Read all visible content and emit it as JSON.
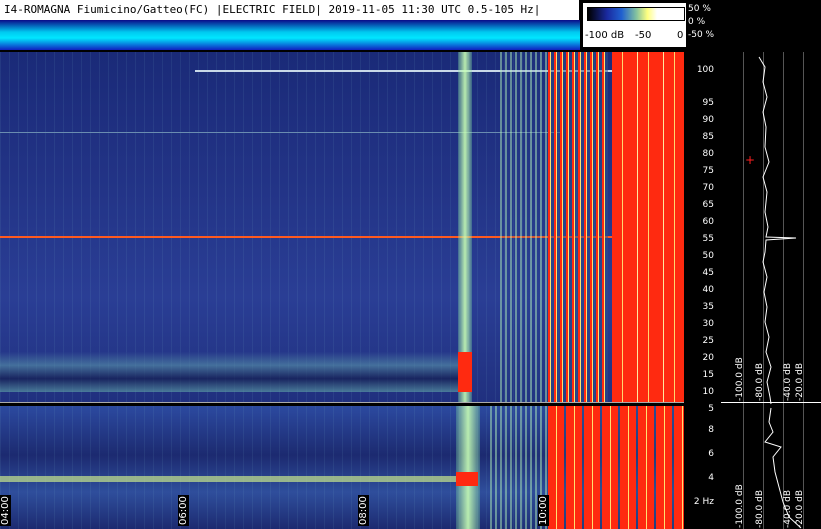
{
  "header": {
    "title": "I4-ROMAGNA Fiumicino/Gatteo(FC) |ELECTRIC FIELD| 2019-11-05 11:30 UTC 0.5-105 Hz|"
  },
  "scale": {
    "labels": [
      "-100 dB",
      "-50",
      "0"
    ],
    "percent_labels": [
      "50 %",
      "0 %",
      "-50 %"
    ]
  },
  "freq_axis_top": {
    "labels": [
      "100",
      "95",
      "90",
      "85",
      "80",
      "75",
      "70",
      "65",
      "60",
      "55",
      "50",
      "45",
      "40",
      "35",
      "30",
      "25",
      "20",
      "15",
      "10",
      "5"
    ]
  },
  "freq_axis_bottom": {
    "labels": [
      "8",
      "6",
      "4",
      "2 Hz"
    ]
  },
  "profile_top": {
    "db_labels": [
      "-100.0 dB",
      "-80.0 dB",
      "-40.0 dB",
      "-20.0 dB"
    ]
  },
  "profile_bottom": {
    "db_labels": [
      "-100.0 dB",
      "-80.0 dB",
      "-40.0 dB",
      "-20.0 dB"
    ]
  },
  "time_axis": {
    "labels": [
      "04:00",
      "06:00",
      "08:00",
      "10:00"
    ]
  },
  "colors": {
    "red_band": "#ff2a10",
    "line_50hz": "#ff5a20",
    "header_band": "#00e6ff",
    "marker": "#ff2020"
  }
}
